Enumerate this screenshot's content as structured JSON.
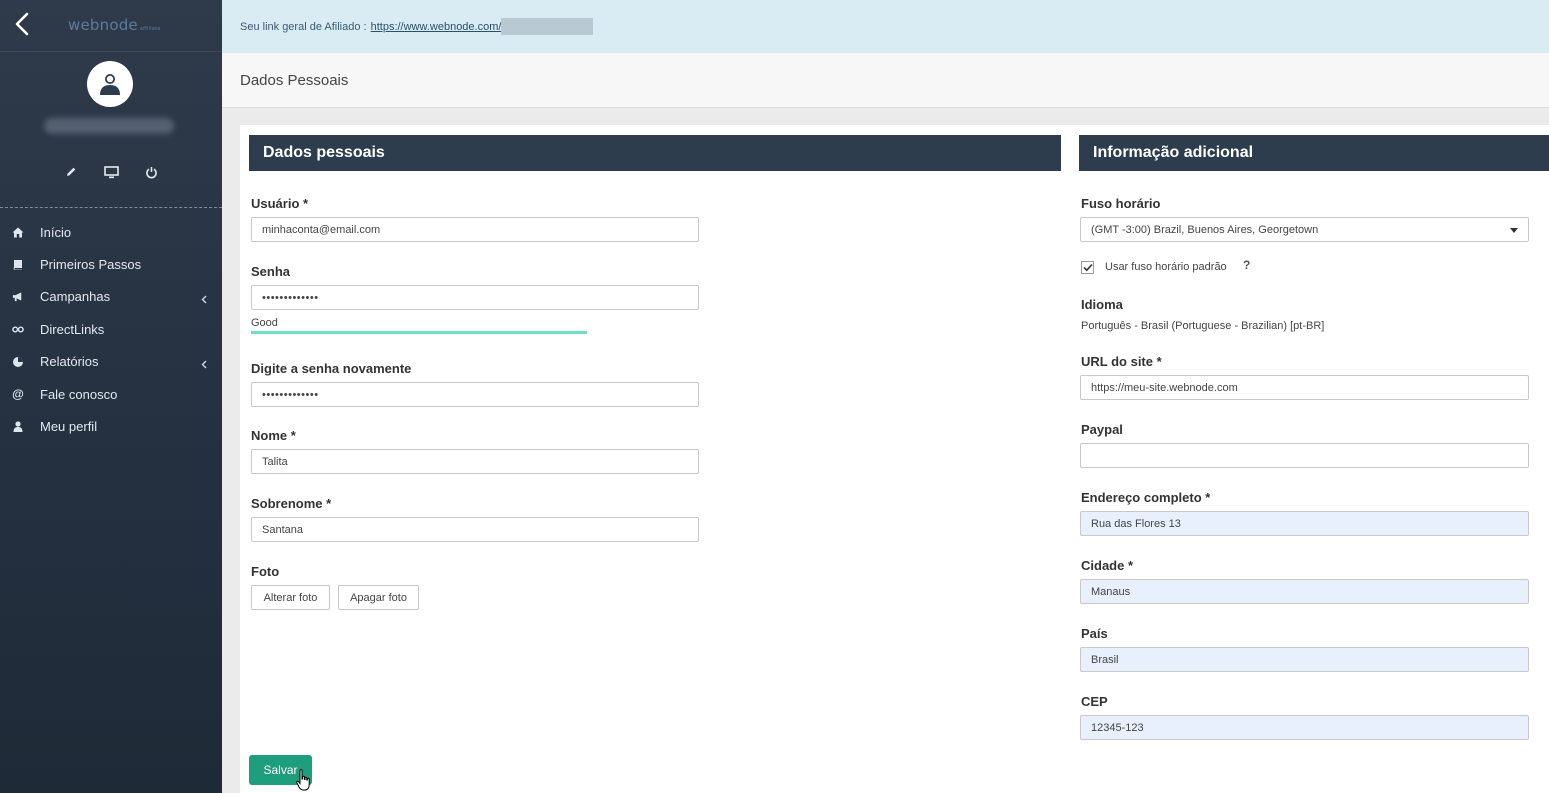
{
  "sidebar": {
    "logo": "webnode",
    "logo_sub": "affiliate",
    "nav": [
      {
        "label": "Início",
        "icon": "home-icon"
      },
      {
        "label": "Primeiros Passos",
        "icon": "book-icon"
      },
      {
        "label": "Campanhas",
        "icon": "megaphone-icon",
        "has_submenu": true
      },
      {
        "label": "DirectLinks",
        "icon": "link-icon"
      },
      {
        "label": "Relatórios",
        "icon": "pie-chart-icon",
        "has_submenu": true
      },
      {
        "label": "Fale conosco",
        "icon": "at-icon"
      },
      {
        "label": "Meu perfil",
        "icon": "user-icon"
      }
    ]
  },
  "banner": {
    "label": "Seu link geral de Afiliado :",
    "link": "https://www.webnode.com/"
  },
  "page_title": "Dados Pessoais",
  "personal": {
    "heading": "Dados pessoais",
    "username_label": "Usuário *",
    "username_value": "minhaconta@email.com",
    "password_label": "Senha",
    "password_value": "•••••••••••••",
    "strength_text": "Good",
    "strength_level": 0.7,
    "password2_label": "Digite a senha novamente",
    "password2_value": "•••••••••••••",
    "first_name_label": "Nome *",
    "first_name_value": "Talita",
    "last_name_label": "Sobrenome *",
    "last_name_value": "Santana",
    "photo_label": "Foto",
    "change_photo": "Alterar foto",
    "delete_photo": "Apagar foto"
  },
  "additional": {
    "heading": "Informação adicional",
    "timezone_label": "Fuso horário",
    "timezone_value": "(GMT -3:00) Brazil, Buenos Aires, Georgetown",
    "default_tz_label": "Usar fuso horário padrão",
    "default_tz_checked": true,
    "help_mark": "?",
    "language_label": "Idioma",
    "language_value": "Português - Brasil (Portuguese - Brazilian) [pt-BR]",
    "site_url_label": "URL do site *",
    "site_url_value": "https://meu-site.webnode.com",
    "paypal_label": "Paypal",
    "paypal_value": "",
    "address_label": "Endereço completo *",
    "address_value": "Rua das Flores 13",
    "city_label": "Cidade *",
    "city_value": "Manaus",
    "country_label": "País",
    "country_value": "Brasil",
    "zip_label": "CEP",
    "zip_value": "12345-123"
  },
  "save_label": "Salvar",
  "colors": {
    "sidebar": "#2f3b4b",
    "panel_header": "#2e3d4e",
    "banner": "#d9ecf4",
    "save_button": "#1e9e7c",
    "strength": "#6ee0c4",
    "autofill": "#e8f0fe"
  }
}
